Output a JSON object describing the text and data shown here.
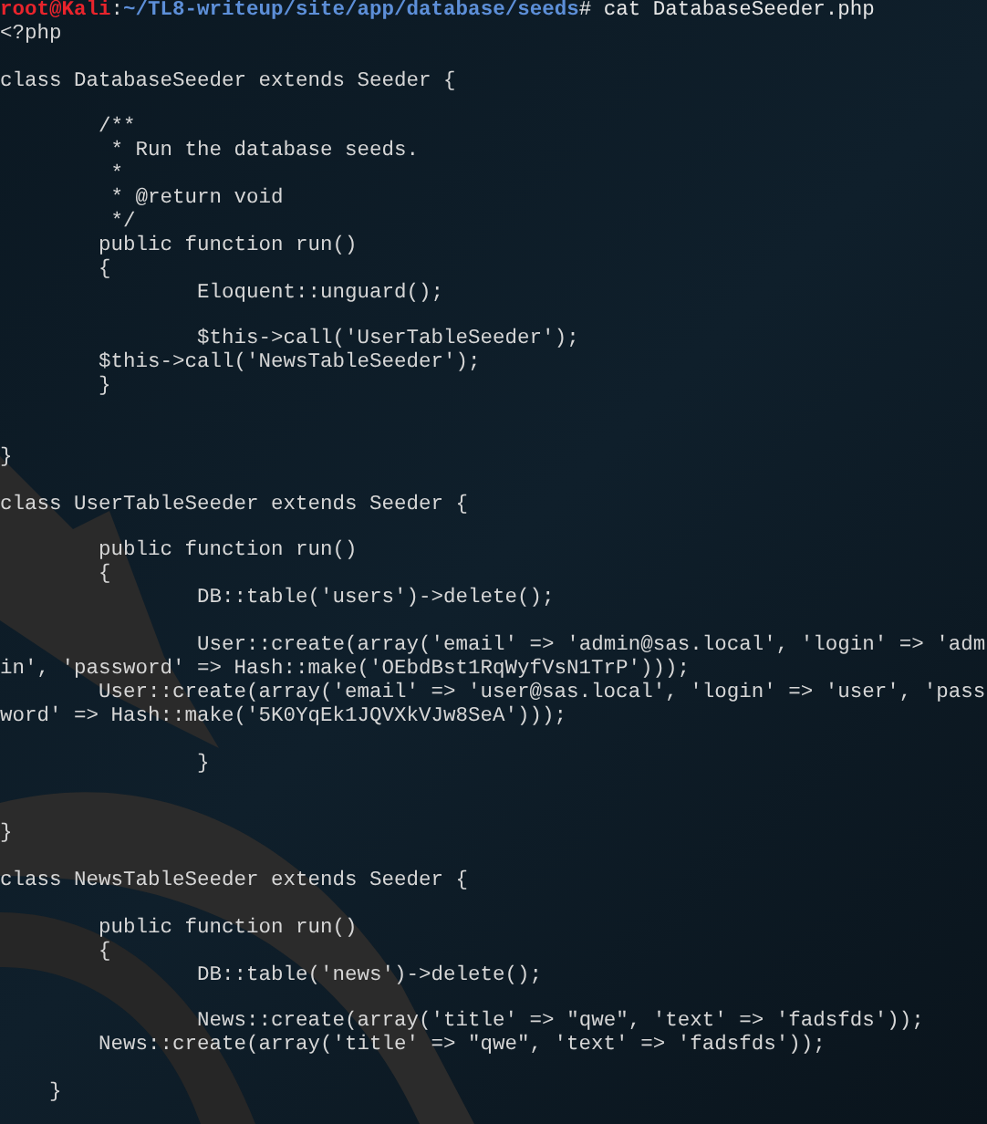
{
  "terminal": {
    "prompt": {
      "user_host": "root@Kali",
      "separator": ":",
      "path": "~/TL8-writeup/site/app/database/seeds",
      "symbol": "#",
      "command": " cat DatabaseSeeder.php"
    },
    "lines": [
      {
        "kind": "code",
        "text": "<?php"
      },
      {
        "kind": "blank"
      },
      {
        "kind": "code",
        "text": "class DatabaseSeeder extends Seeder {"
      },
      {
        "kind": "blank"
      },
      {
        "kind": "code",
        "text": "        /**"
      },
      {
        "kind": "code",
        "text": "         * Run the database seeds."
      },
      {
        "kind": "code",
        "text": "         *"
      },
      {
        "kind": "code",
        "text": "         * @return void"
      },
      {
        "kind": "code",
        "text": "         */"
      },
      {
        "kind": "code",
        "text": "        public function run()"
      },
      {
        "kind": "code",
        "text": "        {"
      },
      {
        "kind": "code",
        "text": "                Eloquent::unguard();"
      },
      {
        "kind": "blank"
      },
      {
        "kind": "code",
        "text": "                $this->call('UserTableSeeder');"
      },
      {
        "kind": "code",
        "text": "        $this->call('NewsTableSeeder');"
      },
      {
        "kind": "code",
        "text": "        }"
      },
      {
        "kind": "blank"
      },
      {
        "kind": "blank"
      },
      {
        "kind": "code",
        "text": "}"
      },
      {
        "kind": "blank"
      },
      {
        "kind": "code",
        "text": "class UserTableSeeder extends Seeder {"
      },
      {
        "kind": "blank"
      },
      {
        "kind": "code",
        "text": "        public function run()"
      },
      {
        "kind": "code",
        "text": "        {"
      },
      {
        "kind": "code",
        "text": "                DB::table('users')->delete();"
      },
      {
        "kind": "blank"
      },
      {
        "kind": "code",
        "text": "                User::create(array('email' => 'admin@sas.local', 'login' => 'adm"
      },
      {
        "kind": "code",
        "text": "in', 'password' => Hash::make('OEbdBst1RqWyfVsN1TrP')));"
      },
      {
        "kind": "code",
        "text": "        User::create(array('email' => 'user@sas.local', 'login' => 'user', 'pass"
      },
      {
        "kind": "code",
        "text": "word' => Hash::make('5K0YqEk1JQVXkVJw8SeA')));"
      },
      {
        "kind": "blank"
      },
      {
        "kind": "code",
        "text": "                }"
      },
      {
        "kind": "blank"
      },
      {
        "kind": "blank"
      },
      {
        "kind": "code",
        "text": "}"
      },
      {
        "kind": "blank"
      },
      {
        "kind": "code",
        "text": "class NewsTableSeeder extends Seeder {"
      },
      {
        "kind": "blank"
      },
      {
        "kind": "code",
        "text": "        public function run()"
      },
      {
        "kind": "code",
        "text": "        {"
      },
      {
        "kind": "code",
        "text": "                DB::table('news')->delete();"
      },
      {
        "kind": "blank"
      },
      {
        "kind": "code",
        "text": "                News::create(array('title' => \"qwe\", 'text' => 'fadsfds'));"
      },
      {
        "kind": "code",
        "text": "        News::create(array('title' => \"qwe\", 'text' => 'fadsfds'));"
      },
      {
        "kind": "blank"
      },
      {
        "kind": "code",
        "text": "    }"
      }
    ]
  }
}
